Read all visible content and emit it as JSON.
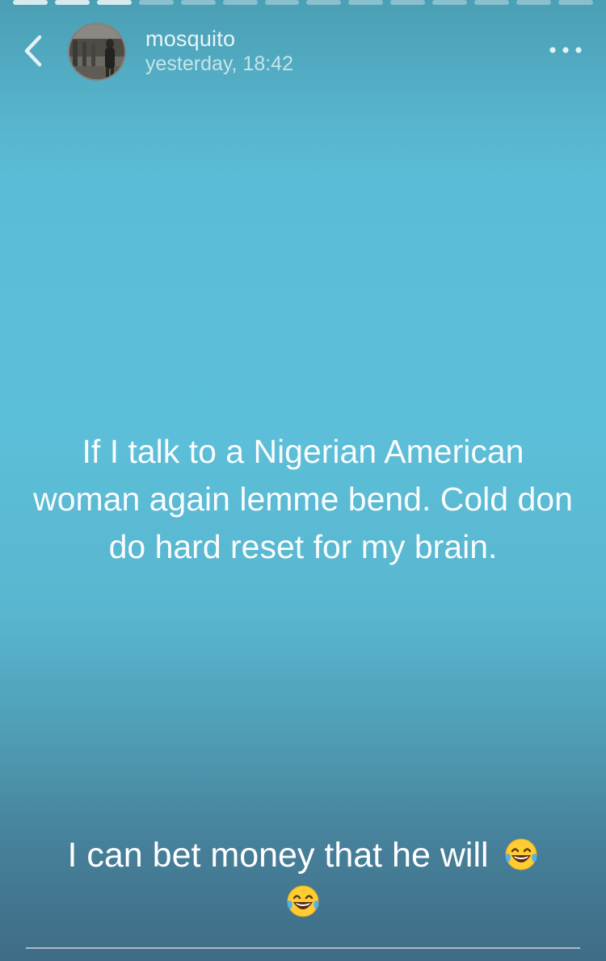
{
  "progress": {
    "segments": 14,
    "completed": 3
  },
  "header": {
    "username": "mosquito",
    "timestamp": "yesterday, 18:42"
  },
  "icons": {
    "back": "chevron-left-icon",
    "more": "more-dots-icon",
    "emoji": "face-with-tears-of-joy"
  },
  "story": {
    "text": "If I talk to a Nigerian American woman again lemme bend. Cold don do hard reset for my brain."
  },
  "caption": {
    "text": "I can bet money that he will"
  },
  "colors": {
    "background_top": "#4a9fb4",
    "background_mid": "#5cbfd9",
    "background_bottom": "#3f6c86",
    "text": "#ffffff"
  }
}
